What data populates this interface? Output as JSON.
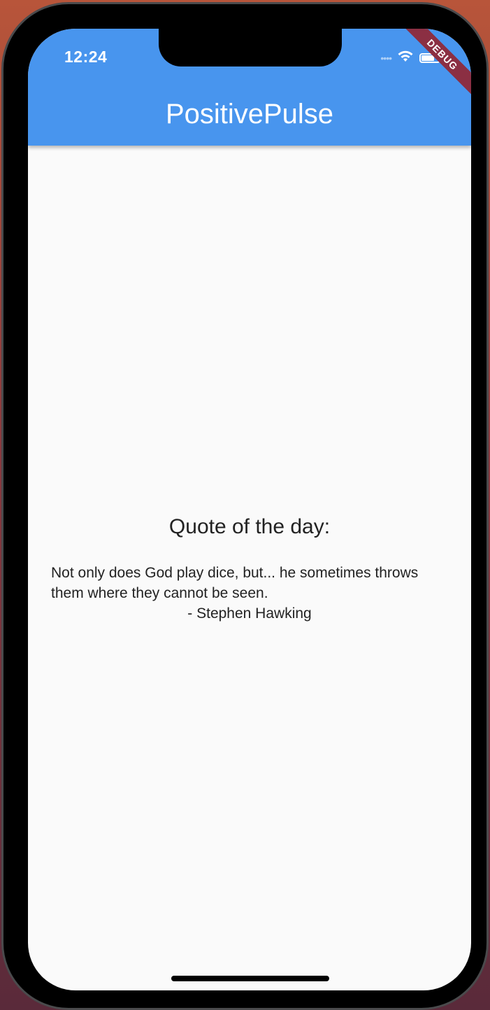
{
  "status_bar": {
    "time": "12:24",
    "signal_icon": "cellular-signal-icon",
    "wifi_icon": "wifi-icon",
    "battery_icon": "battery-icon"
  },
  "debug_banner": {
    "label": "DEBUG"
  },
  "app_bar": {
    "title": "PositivePulse"
  },
  "quote": {
    "heading": "Quote of the day:",
    "text": "Not only does God play dice, but... he sometimes throws them where they cannot be seen.",
    "author": "- Stephen Hawking"
  },
  "colors": {
    "app_bar": "#4895ee",
    "background": "#fafafa",
    "debug_banner": "#8b2f43"
  }
}
